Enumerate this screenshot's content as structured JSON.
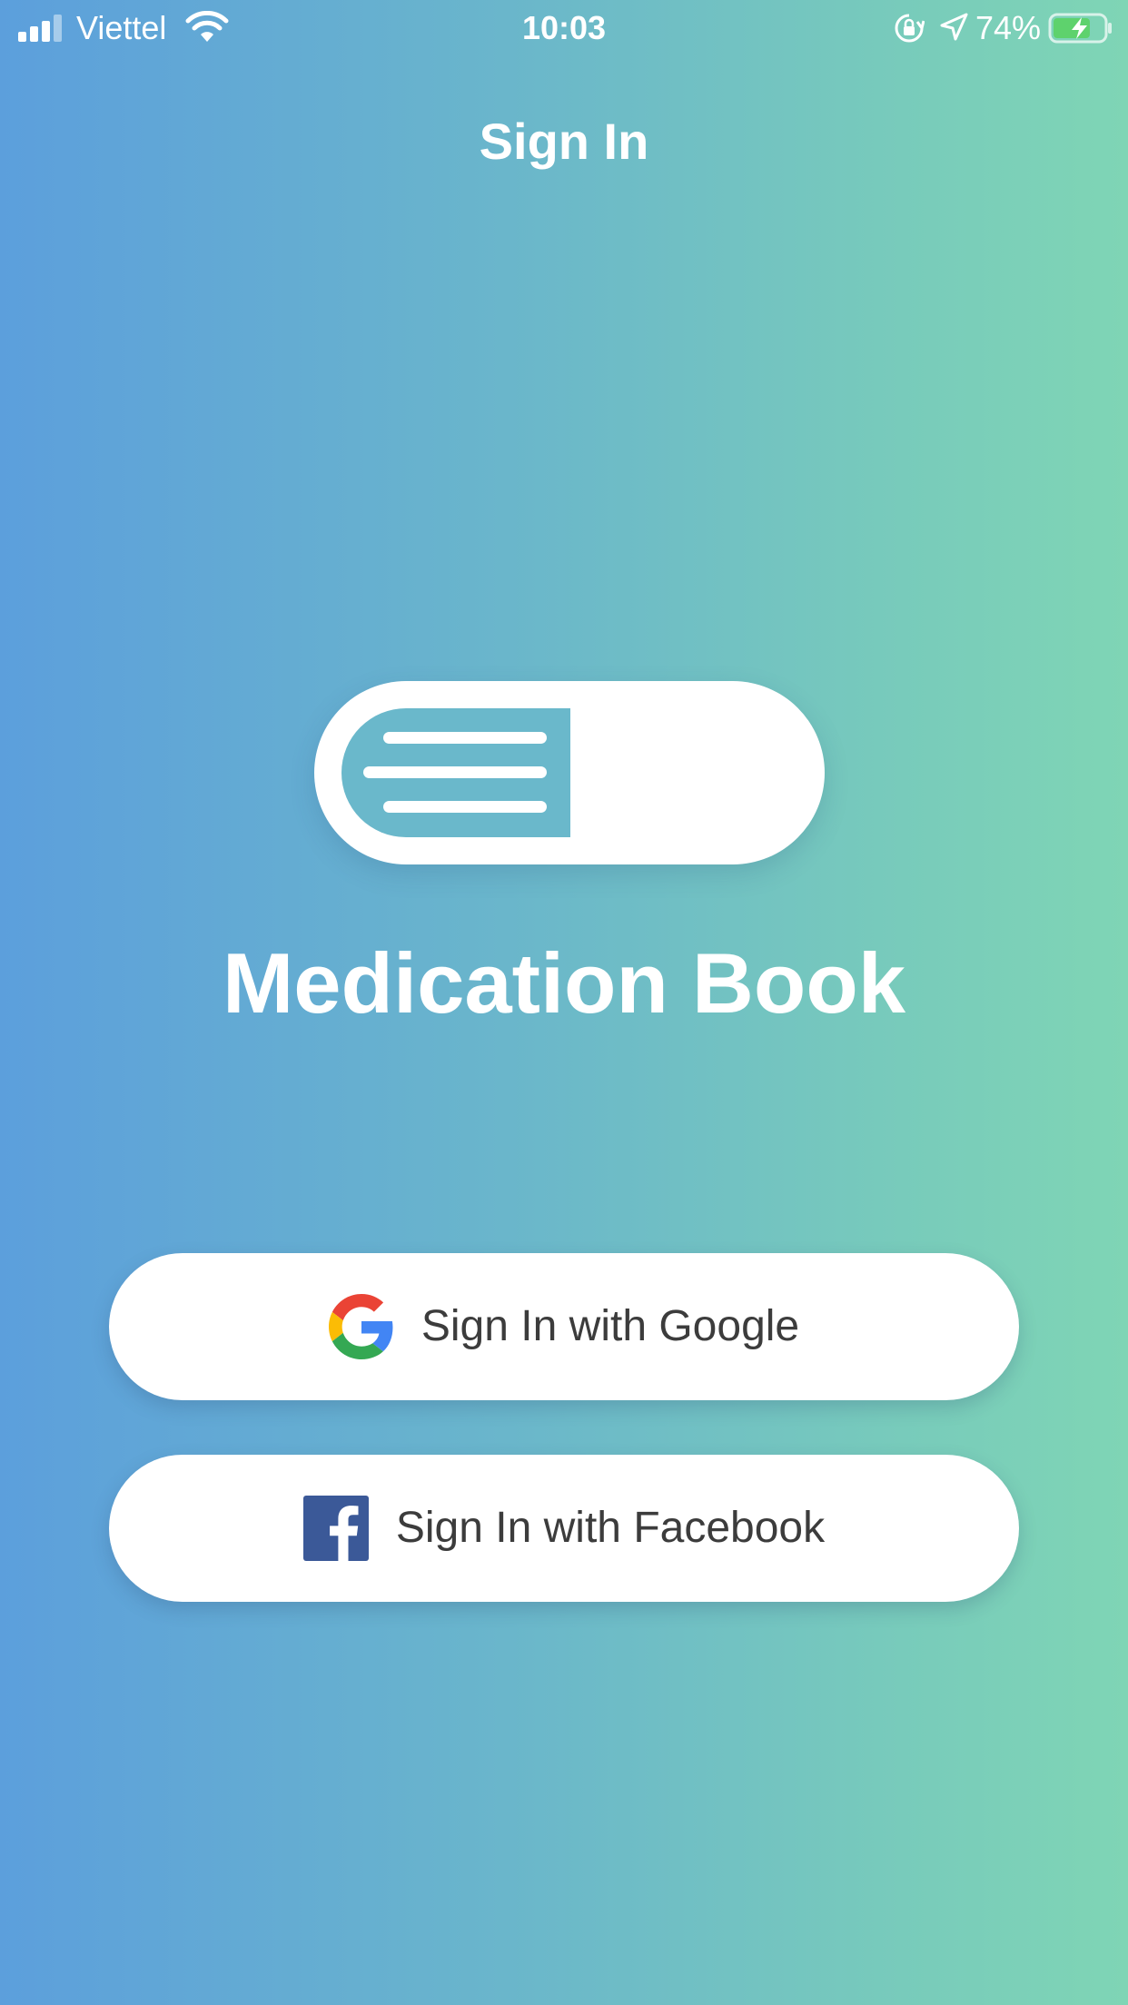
{
  "status_bar": {
    "carrier": "Viettel",
    "time": "10:03",
    "battery_percent": "74%",
    "signal_bars_active": 3,
    "signal_bars_total": 4,
    "battery_level": 0.74,
    "battery_charging": true,
    "icons": [
      "signal-icon",
      "wifi-icon",
      "orientation-lock-icon",
      "location-arrow-icon",
      "battery-charging-icon"
    ]
  },
  "header": {
    "title": "Sign In"
  },
  "branding": {
    "app_name": "Medication Book",
    "logo_icon": "pill-document-logo"
  },
  "buttons": {
    "google_label": "Sign In with Google",
    "google_icon": "google-g-icon",
    "facebook_label": "Sign In with Facebook",
    "facebook_icon": "facebook-f-icon"
  },
  "colors": {
    "gradient_start": "#5c9fdc",
    "gradient_end": "#7fd5b5",
    "logo_accent": "#6ab8cb",
    "facebook_blue": "#3b5998",
    "button_text": "#3c3c3c"
  }
}
